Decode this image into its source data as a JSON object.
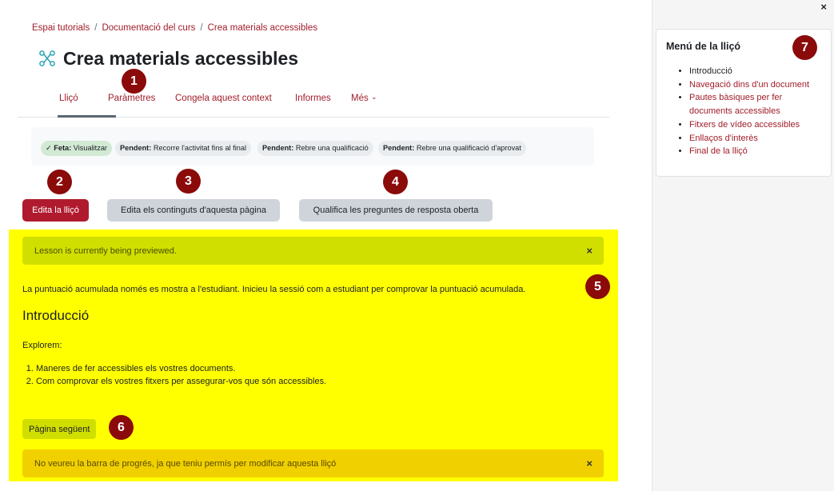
{
  "breadcrumb": [
    "Espai tutorials",
    "Documentació del curs",
    "Crea materials accessibles"
  ],
  "breadcrumb_separator": "/",
  "page_title": "Crea materials accessibles",
  "nav": {
    "tabs": [
      "Lliçó",
      "Paràmetres",
      "Congela aquest context",
      "Informes",
      "Més"
    ],
    "more_caret": "⌄"
  },
  "completion": {
    "items": [
      {
        "status": "Feta:",
        "text": "Visualitzar",
        "done": true,
        "check": "✓"
      },
      {
        "status": "Pendent:",
        "text": "Recorre l'activitat fins al final",
        "done": false
      },
      {
        "status": "Pendent:",
        "text": "Rebre una qualificació",
        "done": false
      },
      {
        "status": "Pendent:",
        "text": "Rebre una qualificació d'aprovat",
        "done": false
      }
    ]
  },
  "buttons": {
    "edit_lesson": "Edita la lliçó",
    "edit_page_contents": "Edita els continguts d'aquesta pàgina",
    "grade_essays": "Qualifica les preguntes de resposta oberta",
    "next_page": "Pàgina següent"
  },
  "alerts": {
    "preview": "Lesson is currently being previewed.",
    "progress": "No veureu la barra de progrés, ja que teniu permís per modificar aquesta lliçó",
    "close": "×"
  },
  "lesson": {
    "score_note": "La puntuació acumulada només es mostra a l'estudiant. Inicieu la sessió com a estudiant per comprovar la puntuació acumulada.",
    "heading": "Introducció",
    "intro": "Explorem:",
    "steps": [
      "Maneres de fer accessibles els vostres documents.",
      "Com comprovar els vostres fitxers per assegurar-vos que són accessibles."
    ]
  },
  "drawer": {
    "close": "×",
    "menu_title": "Menú de la lliçó",
    "items": [
      {
        "label": "Introducció",
        "current": true
      },
      {
        "label": "Navegació dins d'un document",
        "current": false
      },
      {
        "label": "Pautes bàsiques per fer documents accessibles",
        "current": false
      },
      {
        "label": "Fitxers de vídeo accessibles",
        "current": false
      },
      {
        "label": "Enllaços d'interès",
        "current": false
      },
      {
        "label": "Final de la lliçó",
        "current": false
      }
    ]
  },
  "badges": [
    "1",
    "2",
    "3",
    "4",
    "5",
    "6",
    "7"
  ],
  "colors": {
    "accent": "#a01d2a",
    "primary_button": "#b01a2e",
    "highlight": "#ffff00",
    "badge": "#8b0a0a",
    "info_alert": "#d0df00",
    "warning_alert": "#f1d000"
  },
  "icons": {
    "title": "activity-lesson-icon",
    "done": "check-icon",
    "close": "close-icon",
    "more": "chevron-down-icon"
  }
}
